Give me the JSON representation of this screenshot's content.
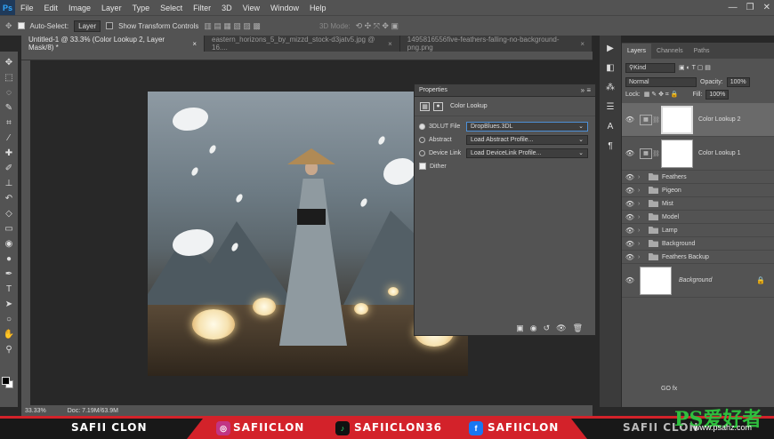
{
  "app": {
    "logo": "Ps"
  },
  "menu": [
    "File",
    "Edit",
    "Image",
    "Layer",
    "Type",
    "Select",
    "Filter",
    "3D",
    "View",
    "Window",
    "Help"
  ],
  "window_controls": [
    "—",
    "❐",
    "✕"
  ],
  "options_bar": {
    "auto_select": "Auto-Select:",
    "auto_select_target": "Layer",
    "transform_controls": "Show Transform Controls",
    "mode_3d": "3D Mode:"
  },
  "doc_tabs": [
    {
      "label": "Untitled-1 @ 33.3% (Color Lookup 2, Layer Mask/8) *",
      "close": "×"
    },
    {
      "label": "eastern_horizons_5_by_mizzd_stock-d3jatv5.jpg @ 16....",
      "close": "×"
    },
    {
      "label": "149581655​6five-feathers-falling-no-background-png.png",
      "close": "×"
    }
  ],
  "properties": {
    "title": "Properties",
    "header_controls": "» ≡",
    "subtitle": "Color Lookup",
    "rows": [
      {
        "label": "3DLUT File",
        "value": "DropBlues.3DL"
      },
      {
        "label": "Abstract",
        "value": "Load Abstract Profile..."
      },
      {
        "label": "Device Link",
        "value": "Load DeviceLink Profile..."
      }
    ],
    "dither_label": "Dither",
    "footer_icons": [
      "▣",
      "◉",
      "↺",
      "👁",
      "🗑"
    ]
  },
  "layers_panel": {
    "tabs": [
      "Layers",
      "Channels",
      "Paths"
    ],
    "filter_kind": "Kind",
    "blend_mode": "Normal",
    "opacity_label": "Opacity:",
    "opacity_value": "100%",
    "lock_label": "Lock:",
    "fill_label": "Fill:",
    "fill_value": "100%",
    "adjustments": [
      "Color Lookup 2",
      "Color Lookup 1"
    ],
    "groups": [
      "Feathers",
      "Pigeon",
      "Mist",
      "Model",
      "Lamp",
      "Background",
      "Feathers Backup"
    ],
    "background_layer": "Background",
    "footer_icons": "GO fx"
  },
  "status": {
    "zoom": "33.33%",
    "doc": "Doc: 7.19M/63.9M"
  },
  "banner": {
    "name": "SAFII CLON",
    "instagram": "SAFIICLON",
    "tiktok": "SAFIICLON36",
    "facebook": "SAFIICLON",
    "name_right": "SAFII CLON"
  },
  "watermark": {
    "text": "PS爱好者",
    "url": "www.psahz.com"
  },
  "colors": {
    "accent_red": "#d3222a",
    "ps_blue": "#31a8ff",
    "watermark_green": "#2fbf3e"
  },
  "icons": [
    "move-icon",
    "marquee-icon",
    "lasso-icon",
    "quick-select-icon",
    "crop-icon",
    "eyedropper-icon",
    "heal-icon",
    "brush-icon",
    "stamp-icon",
    "history-brush-icon",
    "eraser-icon",
    "gradient-icon",
    "blur-icon",
    "dodge-icon",
    "pen-icon",
    "type-icon",
    "path-select-icon",
    "shape-icon",
    "hand-icon",
    "zoom-icon"
  ]
}
